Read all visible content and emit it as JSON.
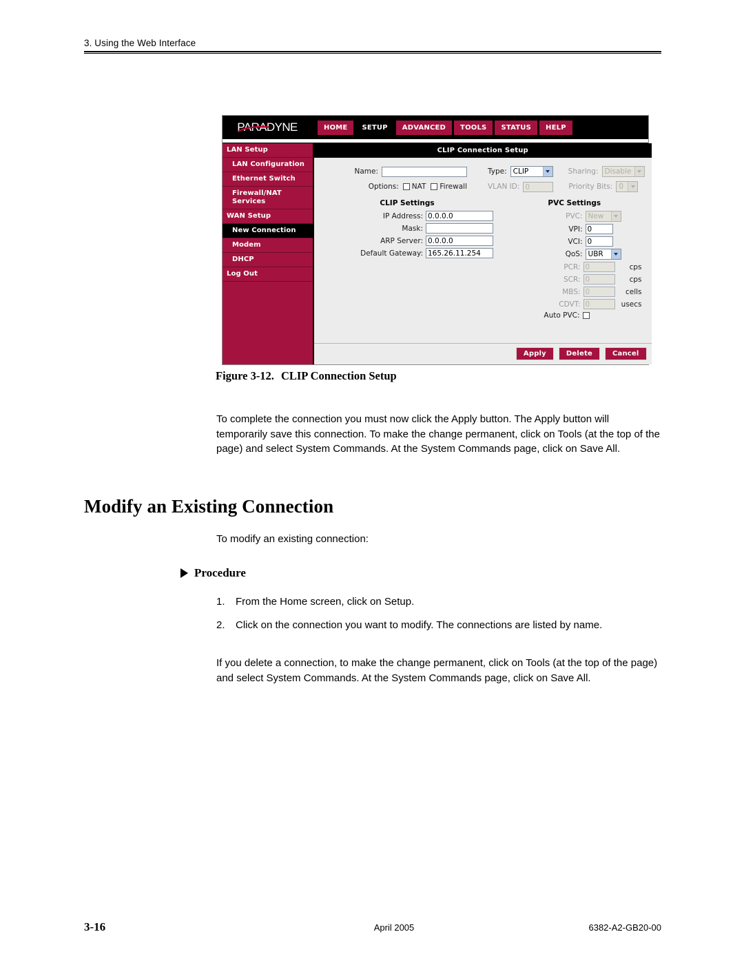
{
  "header": {
    "running_head": "3. Using the Web Interface"
  },
  "figure": {
    "caption_number": "Figure 3-12.",
    "caption_title": "CLIP Connection Setup",
    "webui": {
      "logo": "PARADYNE",
      "nav": [
        {
          "label": "HOME",
          "active": false
        },
        {
          "label": "SETUP",
          "active": true
        },
        {
          "label": "ADVANCED",
          "active": false
        },
        {
          "label": "TOOLS",
          "active": false
        },
        {
          "label": "STATUS",
          "active": false
        },
        {
          "label": "HELP",
          "active": false
        }
      ],
      "sidebar": [
        {
          "label": "LAN Setup",
          "level": "top",
          "selected": false
        },
        {
          "label": "LAN Configuration",
          "level": "sub",
          "selected": false
        },
        {
          "label": "Ethernet Switch",
          "level": "sub",
          "selected": false
        },
        {
          "label": "Firewall/NAT Services",
          "level": "sub",
          "selected": false
        },
        {
          "label": "WAN Setup",
          "level": "top",
          "selected": false
        },
        {
          "label": "New Connection",
          "level": "sub",
          "selected": true
        },
        {
          "label": "Modem",
          "level": "sub",
          "selected": false
        },
        {
          "label": "DHCP",
          "level": "sub",
          "selected": false
        },
        {
          "label": "Log Out",
          "level": "top",
          "selected": false
        }
      ],
      "panel_title": "CLIP Connection Setup",
      "form": {
        "name_label": "Name:",
        "name_value": "",
        "type_label": "Type:",
        "type_value": "CLIP",
        "sharing_label": "Sharing:",
        "sharing_value": "Disable",
        "options_label": "Options:",
        "nat_label": "NAT",
        "nat_checked": false,
        "firewall_label": "Firewall",
        "firewall_checked": false,
        "vlan_id_label": "VLAN ID:",
        "vlan_id_value": "0",
        "priority_bits_label": "Priority Bits:",
        "priority_bits_value": "0"
      },
      "clip_settings": {
        "heading": "CLIP Settings",
        "fields": [
          {
            "label": "IP Address:",
            "value": "0.0.0.0"
          },
          {
            "label": "Mask:",
            "value": ""
          },
          {
            "label": "ARP Server:",
            "value": "0.0.0.0"
          },
          {
            "label": "Default Gateway:",
            "value": "165.26.11.254"
          }
        ]
      },
      "pvc_settings": {
        "heading": "PVC Settings",
        "pvc_label": "PVC:",
        "pvc_value": "New",
        "vpi_label": "VPI:",
        "vpi_value": "0",
        "vci_label": "VCI:",
        "vci_value": "0",
        "qos_label": "QoS:",
        "qos_value": "UBR",
        "rate_fields": [
          {
            "label": "PCR:",
            "value": "0",
            "unit": "cps"
          },
          {
            "label": "SCR:",
            "value": "0",
            "unit": "cps"
          },
          {
            "label": "MBS:",
            "value": "0",
            "unit": "cells"
          },
          {
            "label": "CDVT:",
            "value": "0",
            "unit": "usecs"
          }
        ],
        "auto_pvc_label": "Auto PVC:",
        "auto_pvc_checked": false
      },
      "buttons": [
        {
          "label": "Apply"
        },
        {
          "label": "Delete"
        },
        {
          "label": "Cancel"
        }
      ]
    }
  },
  "body": {
    "para_apply": "To complete the connection you must now click the Apply button. The Apply button will temporarily save this connection. To make the change permanent, click on Tools (at the top of the page) and select System Commands. At the System Commands page, click on Save All.",
    "heading_modify": "Modify an Existing Connection",
    "para_modify_intro": "To modify an existing connection:",
    "procedure_label": "Procedure",
    "steps": [
      {
        "num": "1.",
        "text": "From the Home screen, click on Setup."
      },
      {
        "num": "2.",
        "text": "Click on the connection you want to modify. The connections are listed by name."
      }
    ],
    "para_delete_note": "If you delete a connection, to make the change permanent, click on Tools (at the top of the page) and select System Commands. At the System Commands page, click on Save All."
  },
  "footer": {
    "page_number": "3-16",
    "date": "April 2005",
    "doc_number": "6382-A2-GB20-00"
  },
  "colors": {
    "brand_maroon": "#a4133f",
    "panel_black": "#000000",
    "ui_background": "#ececec"
  }
}
